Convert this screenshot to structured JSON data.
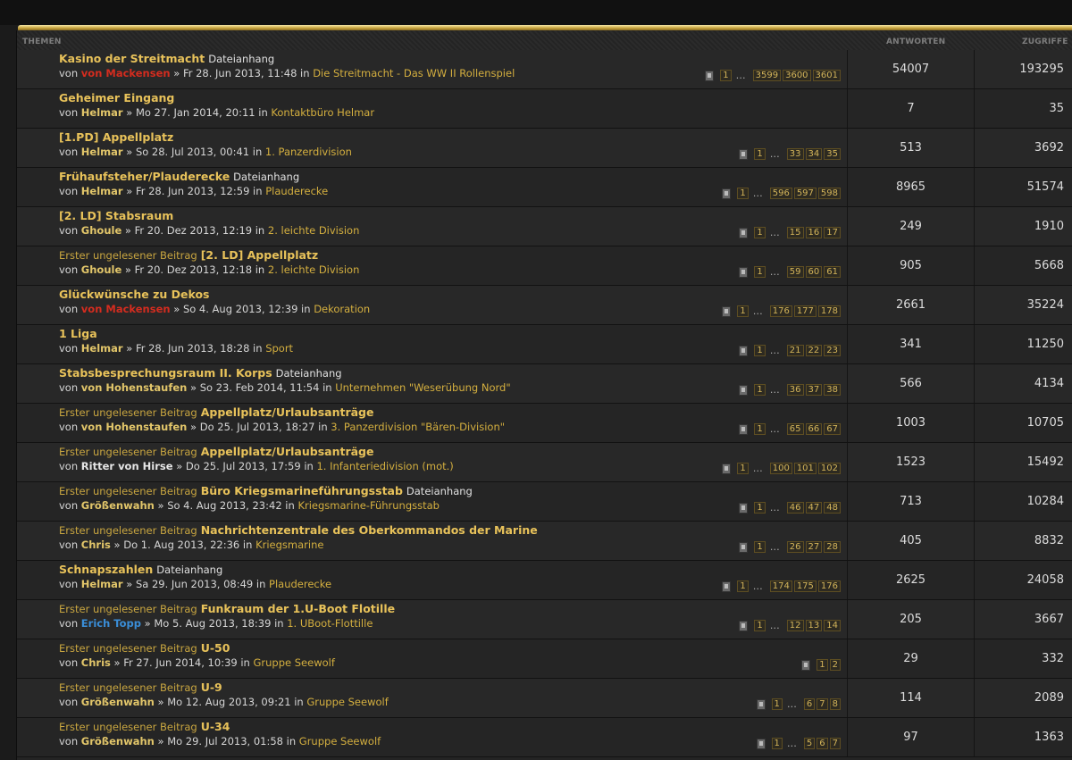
{
  "header": {
    "topics": "THEMEN",
    "replies": "ANTWORTEN",
    "views": "ZUGRIFFE"
  },
  "labels": {
    "by": "von",
    "in": "in",
    "sep": "»",
    "unread": "Erster ungelesener Beitrag",
    "attachment": "Dateianhang",
    "ellipsis": "…"
  },
  "topics": [
    {
      "unread": false,
      "title": "Kasino der Streitmacht",
      "attachment": true,
      "author": "von Mackensen",
      "author_color": "red",
      "date": "Fr 28. Jun 2013, 11:48",
      "forum": "Die Streitmacht - Das WW II Rollenspiel",
      "pages": [
        "1",
        "3599",
        "3600",
        "3601"
      ],
      "replies": "54007",
      "views": "193295"
    },
    {
      "unread": false,
      "title": "Geheimer Eingang",
      "attachment": false,
      "author": "Helmar",
      "author_color": "gold",
      "date": "Mo 27. Jan 2014, 20:11",
      "forum": "Kontaktbüro Helmar",
      "pages": [],
      "replies": "7",
      "views": "35"
    },
    {
      "unread": false,
      "title": "[1.PD] Appellplatz",
      "attachment": false,
      "author": "Helmar",
      "author_color": "gold",
      "date": "So 28. Jul 2013, 00:41",
      "forum": "1. Panzerdivision",
      "pages": [
        "1",
        "33",
        "34",
        "35"
      ],
      "replies": "513",
      "views": "3692"
    },
    {
      "unread": false,
      "title": "Frühaufsteher/Plauderecke",
      "attachment": true,
      "author": "Helmar",
      "author_color": "gold",
      "date": "Fr 28. Jun 2013, 12:59",
      "forum": "Plauderecke",
      "pages": [
        "1",
        "596",
        "597",
        "598"
      ],
      "replies": "8965",
      "views": "51574"
    },
    {
      "unread": false,
      "title": "[2. LD] Stabsraum",
      "attachment": false,
      "author": "Ghoule",
      "author_color": "gold",
      "date": "Fr 20. Dez 2013, 12:19",
      "forum": "2. leichte Division",
      "pages": [
        "1",
        "15",
        "16",
        "17"
      ],
      "replies": "249",
      "views": "1910"
    },
    {
      "unread": true,
      "title": "[2. LD] Appellplatz",
      "attachment": false,
      "author": "Ghoule",
      "author_color": "gold",
      "date": "Fr 20. Dez 2013, 12:18",
      "forum": "2. leichte Division",
      "pages": [
        "1",
        "59",
        "60",
        "61"
      ],
      "replies": "905",
      "views": "5668"
    },
    {
      "unread": false,
      "title": "Glückwünsche zu Dekos",
      "attachment": false,
      "author": "von Mackensen",
      "author_color": "red",
      "date": "So 4. Aug 2013, 12:39",
      "forum": "Dekoration",
      "pages": [
        "1",
        "176",
        "177",
        "178"
      ],
      "replies": "2661",
      "views": "35224"
    },
    {
      "unread": false,
      "title": "1 Liga",
      "attachment": false,
      "author": "Helmar",
      "author_color": "gold",
      "date": "Fr 28. Jun 2013, 18:28",
      "forum": "Sport",
      "pages": [
        "1",
        "21",
        "22",
        "23"
      ],
      "replies": "341",
      "views": "11250"
    },
    {
      "unread": false,
      "title": "Stabsbesprechungsraum II. Korps",
      "attachment": true,
      "author": "von Hohenstaufen",
      "author_color": "gold",
      "date": "So 23. Feb 2014, 11:54",
      "forum": "Unternehmen \"Weserübung Nord\"",
      "pages": [
        "1",
        "36",
        "37",
        "38"
      ],
      "replies": "566",
      "views": "4134"
    },
    {
      "unread": true,
      "title": "Appellplatz/Urlaubsanträge",
      "attachment": false,
      "author": "von Hohenstaufen",
      "author_color": "gold",
      "date": "Do 25. Jul 2013, 18:27",
      "forum": "3. Panzerdivision \"Bären-Division\"",
      "pages": [
        "1",
        "65",
        "66",
        "67"
      ],
      "replies": "1003",
      "views": "10705"
    },
    {
      "unread": true,
      "title": "Appellplatz/Urlaubsanträge",
      "attachment": false,
      "author": "Ritter von Hirse",
      "author_color": "white",
      "date": "Do 25. Jul 2013, 17:59",
      "forum": "1. Infanteriedivision (mot.)",
      "pages": [
        "1",
        "100",
        "101",
        "102"
      ],
      "replies": "1523",
      "views": "15492"
    },
    {
      "unread": true,
      "title": "Büro Kriegsmarineführungsstab",
      "attachment": true,
      "author": "Größenwahn",
      "author_color": "gold",
      "date": "So 4. Aug 2013, 23:42",
      "forum": "Kriegsmarine-Führungsstab",
      "pages": [
        "1",
        "46",
        "47",
        "48"
      ],
      "replies": "713",
      "views": "10284"
    },
    {
      "unread": true,
      "title": "Nachrichtenzentrale des Oberkommandos der Marine",
      "attachment": false,
      "author": "Chris",
      "author_color": "gold",
      "date": "Do 1. Aug 2013, 22:36",
      "forum": "Kriegsmarine",
      "pages": [
        "1",
        "26",
        "27",
        "28"
      ],
      "replies": "405",
      "views": "8832"
    },
    {
      "unread": false,
      "title": "Schnapszahlen",
      "attachment": true,
      "author": "Helmar",
      "author_color": "gold",
      "date": "Sa 29. Jun 2013, 08:49",
      "forum": "Plauderecke",
      "pages": [
        "1",
        "174",
        "175",
        "176"
      ],
      "replies": "2625",
      "views": "24058"
    },
    {
      "unread": true,
      "title": "Funkraum der 1.U-Boot Flotille",
      "attachment": false,
      "author": "Erich Topp",
      "author_color": "blue",
      "date": "Mo 5. Aug 2013, 18:39",
      "forum": "1. UBoot-Flottille",
      "pages": [
        "1",
        "12",
        "13",
        "14"
      ],
      "replies": "205",
      "views": "3667"
    },
    {
      "unread": true,
      "title": "U-50",
      "attachment": false,
      "author": "Chris",
      "author_color": "gold",
      "date": "Fr 27. Jun 2014, 10:39",
      "forum": "Gruppe Seewolf",
      "pages": [
        "1",
        "2"
      ],
      "replies": "29",
      "views": "332"
    },
    {
      "unread": true,
      "title": "U-9",
      "attachment": false,
      "author": "Größenwahn",
      "author_color": "gold",
      "date": "Mo 12. Aug 2013, 09:21",
      "forum": "Gruppe Seewolf",
      "pages": [
        "1",
        "6",
        "7",
        "8"
      ],
      "replies": "114",
      "views": "2089"
    },
    {
      "unread": true,
      "title": "U-34",
      "attachment": false,
      "author": "Größenwahn",
      "author_color": "gold",
      "date": "Mo 29. Jul 2013, 01:58",
      "forum": "Gruppe Seewolf",
      "pages": [
        "1",
        "5",
        "6",
        "7"
      ],
      "replies": "97",
      "views": "1363"
    }
  ]
}
